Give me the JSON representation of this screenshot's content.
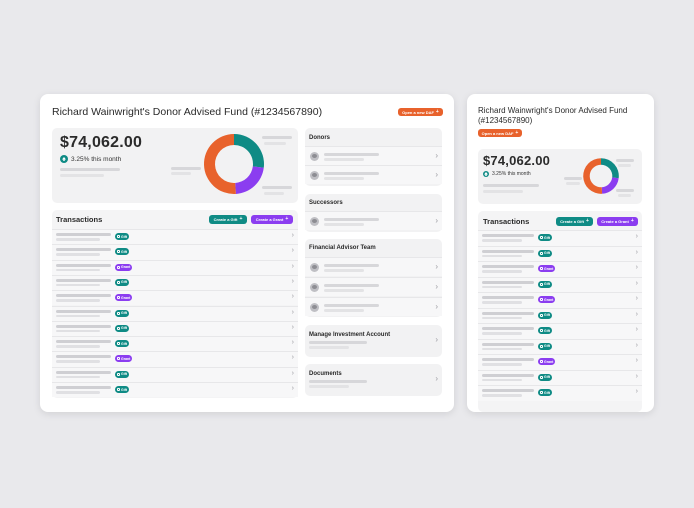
{
  "fund": {
    "title": "Richard Wainwright's Donor Advised Fund (#1234567890)",
    "title_line1": "Richard Wainwright's Donor Advised Fund",
    "title_line2": "(#1234567890)",
    "open_daf_label": "Open a new DAF",
    "balance": "$74,062.00",
    "growth": "3.25% this month"
  },
  "donut": {
    "segments": [
      {
        "color": "#0f8b85",
        "fraction": 0.27
      },
      {
        "color": "#8b3df0",
        "fraction": 0.22
      },
      {
        "color": "#e8622c",
        "fraction": 0.51
      }
    ]
  },
  "transactions": {
    "title": "Transactions",
    "create_gift_label": "Create a Gift",
    "create_grant_label": "Create a Grant",
    "gift_badge": "Gift",
    "grant_badge": "Grant",
    "rows": [
      "gift",
      "gift",
      "grant",
      "gift",
      "grant",
      "gift",
      "gift",
      "gift",
      "grant",
      "gift",
      "gift"
    ]
  },
  "side": {
    "donors": "Donors",
    "successors": "Successors",
    "advisor_team": "Financial Advisor Team",
    "investment": "Manage Investment Account",
    "documents": "Documents"
  },
  "colors": {
    "accent_teal": "#0f8b85",
    "accent_purple": "#8b3df0",
    "accent_orange": "#e8622c",
    "background": "#e9e9ec"
  },
  "icons": {
    "chevron": "chevron-right-icon",
    "growth": "arrow-up-icon",
    "person": "avatar-icon",
    "plus": "plus-icon"
  }
}
